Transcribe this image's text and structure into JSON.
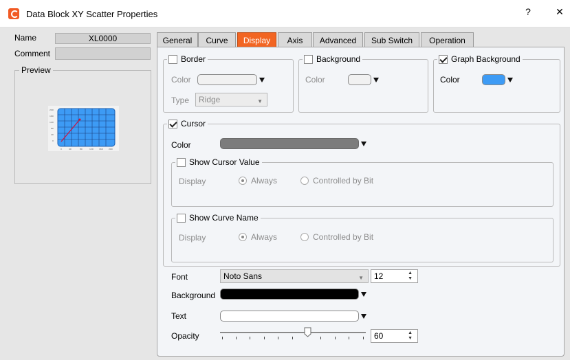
{
  "window": {
    "title": "Data Block XY Scatter Properties",
    "help": "?",
    "close": "✕"
  },
  "left": {
    "name_label": "Name",
    "name_value": "XL0000",
    "comment_label": "Comment",
    "comment_value": "",
    "preview_label": "Preview"
  },
  "tabs": [
    {
      "label": "General"
    },
    {
      "label": "Curve"
    },
    {
      "label": "Display"
    },
    {
      "label": "Axis"
    },
    {
      "label": "Advanced"
    },
    {
      "label": "Sub Switch"
    },
    {
      "label": "Operation"
    }
  ],
  "active_tab": "Display",
  "border": {
    "title": "Border",
    "checked": false,
    "color_label": "Color",
    "type_label": "Type",
    "type_value": "Ridge"
  },
  "background": {
    "title": "Background",
    "checked": false,
    "color_label": "Color"
  },
  "graph_background": {
    "title": "Graph Background",
    "checked": true,
    "color_label": "Color",
    "color": "#3d9bf5"
  },
  "cursor": {
    "title": "Cursor",
    "checked": true,
    "color_label": "Color",
    "color": "#7c7c7c",
    "show_value": {
      "title": "Show Cursor Value",
      "checked": false,
      "display_label": "Display",
      "opt_always": "Always",
      "opt_bit": "Controlled by Bit",
      "selected": "Always"
    },
    "show_name": {
      "title": "Show Curve Name",
      "checked": false,
      "display_label": "Display",
      "opt_always": "Always",
      "opt_bit": "Controlled by Bit",
      "selected": "Always"
    }
  },
  "text_settings": {
    "font_label": "Font",
    "font_value": "Noto Sans",
    "size_value": "12",
    "background_label": "Background",
    "background_color": "#000000",
    "text_label": "Text",
    "text_color": "#ffffff",
    "opacity_label": "Opacity",
    "opacity_value": "60"
  },
  "colors": {
    "accent": "#f26522",
    "panel": "#f3f5f8",
    "frame": "#e6e6e6"
  }
}
